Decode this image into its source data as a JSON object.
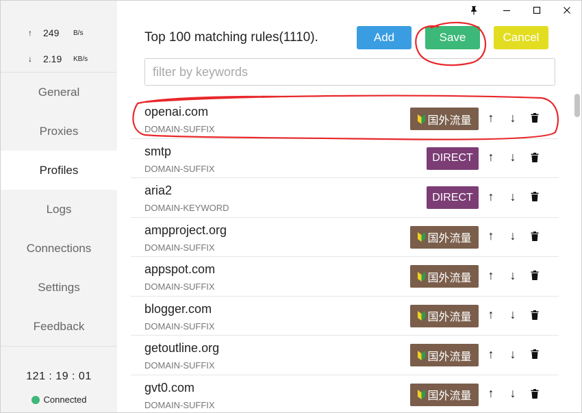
{
  "window": {
    "pin_icon": "pin-icon",
    "minimize_icon": "minimize-icon",
    "maximize_icon": "maximize-icon",
    "close_icon": "close-icon"
  },
  "sidebar": {
    "upload": {
      "arrow": "↑",
      "value": "249",
      "unit": "B/s"
    },
    "download": {
      "arrow": "↓",
      "value": "2.19",
      "unit": "KB/s"
    },
    "nav": [
      {
        "label": "General",
        "active": false
      },
      {
        "label": "Proxies",
        "active": false
      },
      {
        "label": "Profiles",
        "active": true
      },
      {
        "label": "Logs",
        "active": false
      },
      {
        "label": "Connections",
        "active": false
      },
      {
        "label": "Settings",
        "active": false
      },
      {
        "label": "Feedback",
        "active": false
      }
    ],
    "uptime": "121 : 19 : 01",
    "status": "Connected",
    "status_color": "#3cb878"
  },
  "main": {
    "title": "Top 100 matching rules(1110).",
    "buttons": {
      "add": "Add",
      "save": "Save",
      "cancel": "Cancel"
    },
    "filter_placeholder": "filter by keywords",
    "rules": [
      {
        "pattern": "openai.com",
        "type": "DOMAIN-SUFFIX",
        "target": "国外流量",
        "target_kind": "proxy"
      },
      {
        "pattern": "smtp",
        "type": "DOMAIN-SUFFIX",
        "target": "DIRECT",
        "target_kind": "direct"
      },
      {
        "pattern": "aria2",
        "type": "DOMAIN-KEYWORD",
        "target": "DIRECT",
        "target_kind": "direct"
      },
      {
        "pattern": "ampproject.org",
        "type": "DOMAIN-SUFFIX",
        "target": "国外流量",
        "target_kind": "proxy"
      },
      {
        "pattern": "appspot.com",
        "type": "DOMAIN-SUFFIX",
        "target": "国外流量",
        "target_kind": "proxy"
      },
      {
        "pattern": "blogger.com",
        "type": "DOMAIN-SUFFIX",
        "target": "国外流量",
        "target_kind": "proxy"
      },
      {
        "pattern": "getoutline.org",
        "type": "DOMAIN-SUFFIX",
        "target": "国外流量",
        "target_kind": "proxy"
      },
      {
        "pattern": "gvt0.com",
        "type": "DOMAIN-SUFFIX",
        "target": "国外流量",
        "target_kind": "proxy"
      }
    ],
    "actions": {
      "up": "↑",
      "down": "↓"
    }
  },
  "colors": {
    "add": "#3a9de2",
    "save": "#3cb878",
    "cancel": "#e3dd22",
    "proxy_target": "#7a5e4b",
    "direct_target": "#7b3d74",
    "annotation": "#e8282b"
  }
}
